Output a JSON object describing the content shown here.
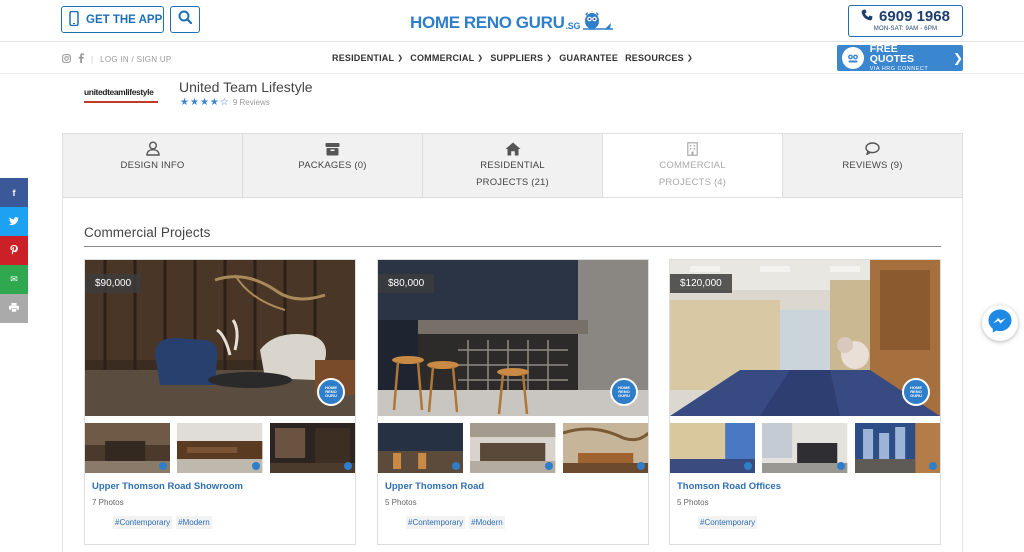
{
  "header": {
    "app_button_label": "GET THE APP",
    "logo": {
      "home": "HOME",
      "reno": "RENO",
      "guru": "GURU",
      "suffix": ".SG"
    },
    "phone": {
      "number": "6909 1968",
      "hours": "MON-SAT: 9AM - 6PM"
    }
  },
  "nav": {
    "login_label": "LOG IN / SIGN UP",
    "separator": "|",
    "menu": [
      {
        "label": "RESIDENTIAL",
        "has_dropdown": true
      },
      {
        "label": "COMMERCIAL",
        "has_dropdown": true
      },
      {
        "label": "SUPPLIERS",
        "has_dropdown": true
      },
      {
        "label": "GUARANTEE",
        "has_dropdown": false
      },
      {
        "label": "RESOURCES",
        "has_dropdown": true
      }
    ],
    "free_quotes": {
      "main": "FREE QUOTES",
      "sub": "VIA HRG CONNECT"
    }
  },
  "company": {
    "logo_text": "unitedteamlifestyle",
    "name": "United Team Lifestyle",
    "rating": 4,
    "rating_max": 5,
    "reviews_label": "9 Reviews"
  },
  "tabs": [
    {
      "line1": "DESIGN INFO",
      "line2": "",
      "icon": "user-icon",
      "active": false
    },
    {
      "line1": "PACKAGES (0)",
      "line2": "",
      "icon": "box-icon",
      "active": false
    },
    {
      "line1": "RESIDENTIAL",
      "line2": "PROJECTS (21)",
      "icon": "home-icon",
      "active": false
    },
    {
      "line1": "COMMERCIAL",
      "line2": "PROJECTS (4)",
      "icon": "building-icon",
      "active": true
    },
    {
      "line1": "REVIEWS (9)",
      "line2": "",
      "icon": "comment-icon",
      "active": false
    }
  ],
  "section": {
    "title": "Commercial Projects"
  },
  "projects": [
    {
      "price": "$90,000",
      "title": "Upper Thomson Road Showroom",
      "photos": "7 Photos",
      "tags": [
        "#Contemporary",
        "#Modern"
      ]
    },
    {
      "price": "$80,000",
      "title": "Upper Thomson Road",
      "photos": "5 Photos",
      "tags": [
        "#Contemporary",
        "#Modern"
      ]
    },
    {
      "price": "$120,000",
      "title": "Thomson Road Offices",
      "photos": "5 Photos",
      "tags": [
        "#Contemporary"
      ]
    }
  ],
  "badge_text": "HOME RENO GURU",
  "share": [
    {
      "icon": "facebook-icon",
      "glyph": "f",
      "color": "#3b5998"
    },
    {
      "icon": "twitter-icon",
      "glyph": "t",
      "color": "#1da1f2"
    },
    {
      "icon": "pinterest-icon",
      "glyph": "p",
      "color": "#cb2027"
    },
    {
      "icon": "email-icon",
      "glyph": "✉",
      "color": "#2fa84f"
    },
    {
      "icon": "print-icon",
      "glyph": "⎙",
      "color": "#aaaaaa"
    }
  ],
  "colors": {
    "brand_blue": "#2f7ec9",
    "nav_dark": "#1e3e6b",
    "link": "#2f6fb3"
  }
}
